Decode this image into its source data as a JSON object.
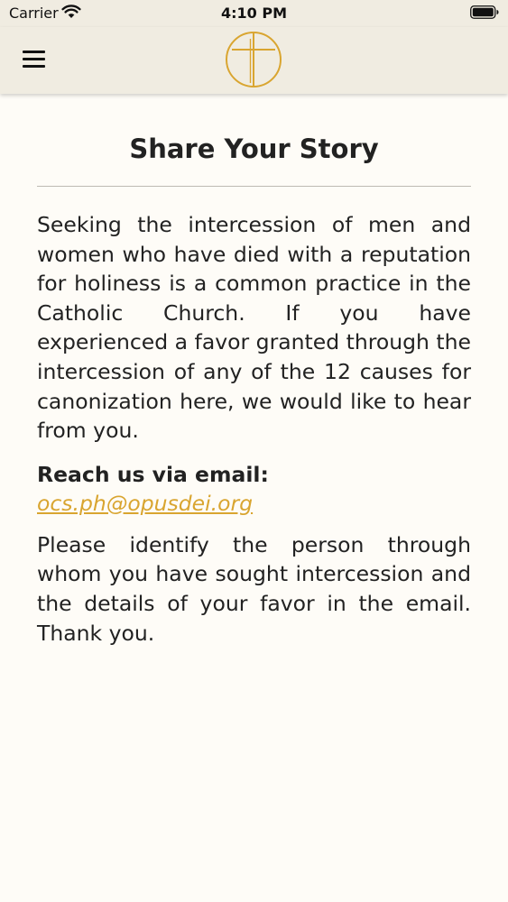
{
  "status_bar": {
    "carrier": "Carrier",
    "time": "4:10 PM"
  },
  "icons": {
    "wifi": "wifi-icon",
    "battery": "battery-icon",
    "menu": "hamburger-menu-icon",
    "logo": "cross-in-circle-logo"
  },
  "colors": {
    "background": "#fefcf7",
    "nav_background": "#f0ece1",
    "accent": "#d9a530",
    "text": "#222222"
  },
  "page": {
    "title": "Share Your Story",
    "intro": "Seeking the intercession of men and women who have died with a reputation for holiness is a common practice in the Catholic Church. If you have experienced a favor granted through the intercession of any of the 12 causes for canonization here, we would like to hear from you.",
    "reach_label": "Reach us via email:",
    "email": "ocs.ph@opusdei.org",
    "closing": "Please identify the person through whom you have sought intercession and the details of your favor in the email. Thank you."
  }
}
